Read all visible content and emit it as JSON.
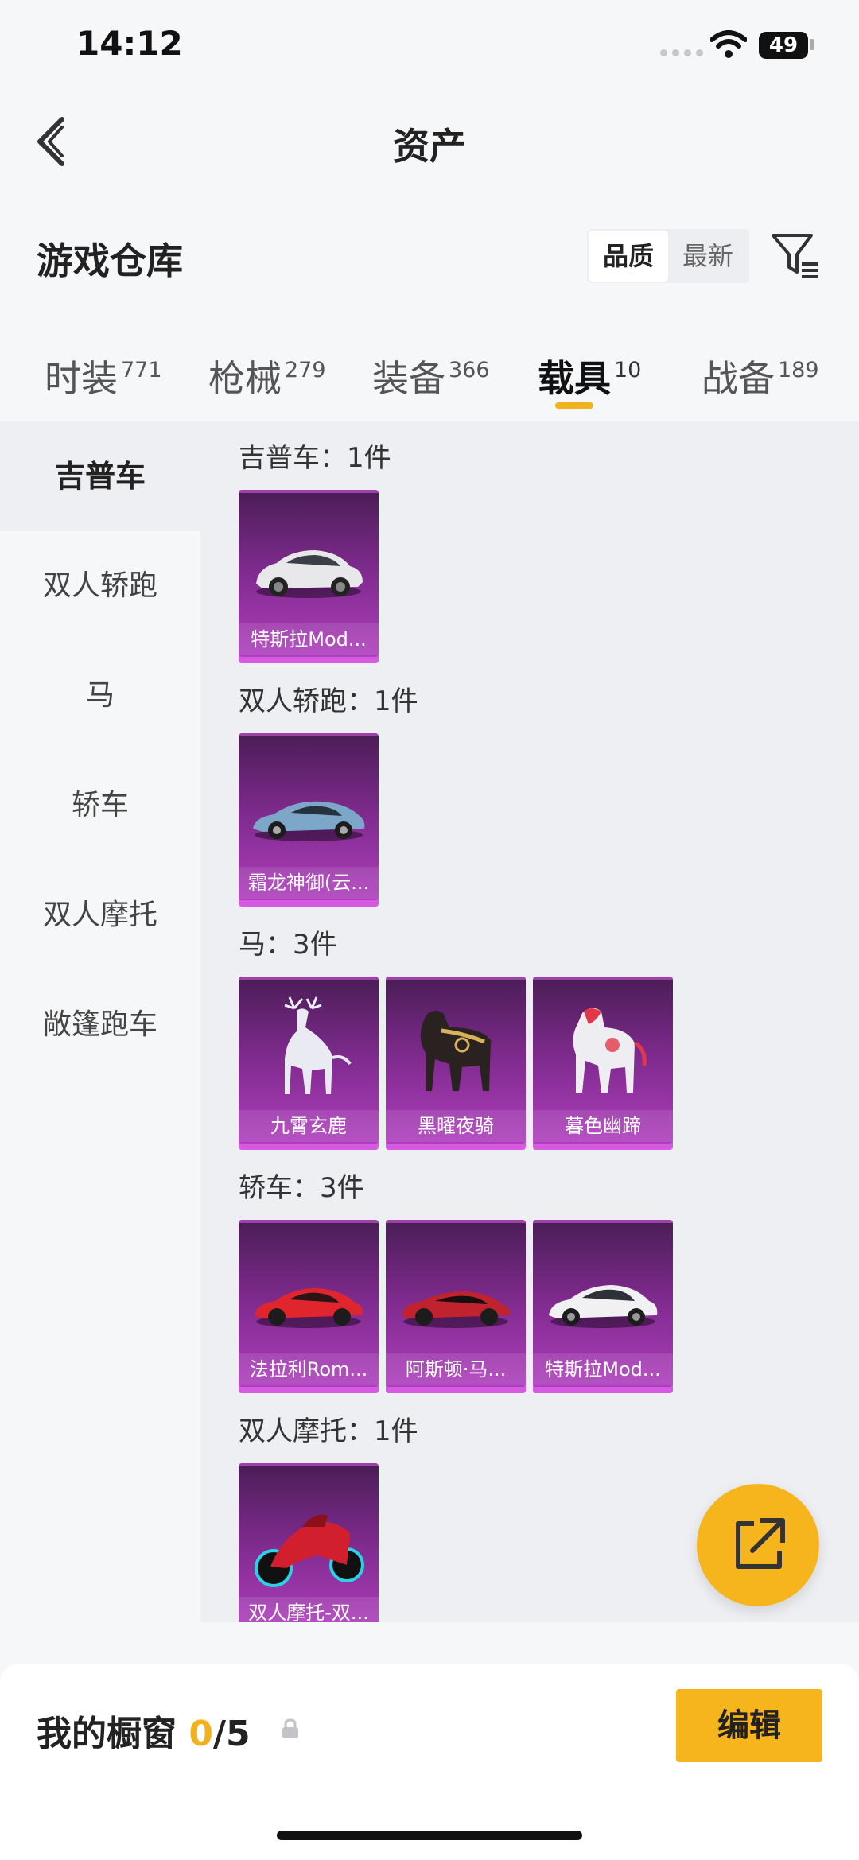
{
  "status": {
    "time": "14:12",
    "battery": "49"
  },
  "header": {
    "title": "资产"
  },
  "warehouse": {
    "title": "游戏仓库"
  },
  "sort": {
    "quality": "品质",
    "latest": "最新"
  },
  "tabs": [
    {
      "label": "时装",
      "count": "771"
    },
    {
      "label": "枪械",
      "count": "279"
    },
    {
      "label": "装备",
      "count": "366"
    },
    {
      "label": "载具",
      "count": "10"
    },
    {
      "label": "战备",
      "count": "189"
    }
  ],
  "sidebar": [
    {
      "label": "吉普车"
    },
    {
      "label": "双人轿跑"
    },
    {
      "label": "马"
    },
    {
      "label": "轿车"
    },
    {
      "label": "双人摩托"
    },
    {
      "label": "敞篷跑车"
    }
  ],
  "sections": [
    {
      "label": "吉普车：1件",
      "items": [
        {
          "name": "特斯拉Mod..."
        }
      ]
    },
    {
      "label": "双人轿跑：1件",
      "items": [
        {
          "name": "霜龙神御(云..."
        }
      ]
    },
    {
      "label": "马：3件",
      "items": [
        {
          "name": "九霄玄鹿"
        },
        {
          "name": "黑曜夜骑"
        },
        {
          "name": "暮色幽蹄"
        }
      ]
    },
    {
      "label": "轿车：3件",
      "items": [
        {
          "name": "法拉利Rom..."
        },
        {
          "name": "阿斯顿·马..."
        },
        {
          "name": "特斯拉Mod..."
        }
      ]
    },
    {
      "label": "双人摩托：1件",
      "items": [
        {
          "name": "双人摩托-双..."
        }
      ]
    }
  ],
  "bottom": {
    "title": "我的橱窗",
    "count": "0",
    "total": "/5",
    "edit": "编辑"
  },
  "colors": {
    "accent": "#f6b51c",
    "card_top": "#4a1d55",
    "card_bottom": "#b23fc0"
  },
  "icons": {
    "back": "chevron-left-icon",
    "filter": "filter-list-icon",
    "share": "share-external-icon",
    "lock": "lock-icon"
  }
}
